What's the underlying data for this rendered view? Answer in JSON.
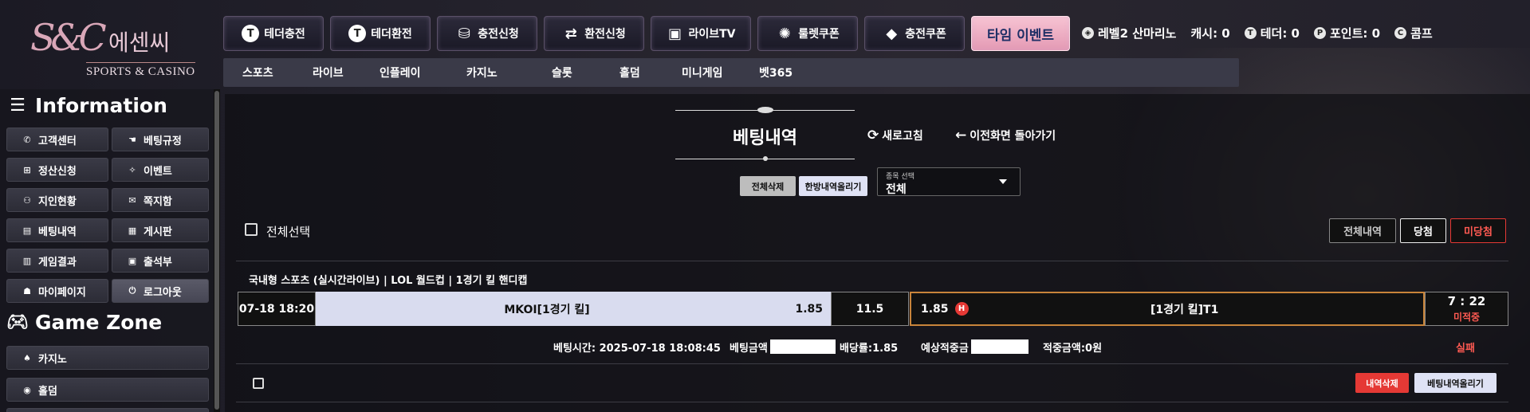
{
  "logo": {
    "mark": "S&C",
    "korean": "에센씨",
    "sub": "SPORTS & CASINO"
  },
  "top_buttons": [
    {
      "label": "테더충전",
      "icon": "tether-icon"
    },
    {
      "label": "테더환전",
      "icon": "tether-icon"
    },
    {
      "label": "충전신청",
      "icon": "coins-icon"
    },
    {
      "label": "환전신청",
      "icon": "exchange-icon"
    },
    {
      "label": "라이브TV",
      "icon": "live-tv-icon"
    },
    {
      "label": "룰렛쿠폰",
      "icon": "roulette-icon"
    },
    {
      "label": "충전쿠폰",
      "icon": "coupon-icon"
    }
  ],
  "event_button": "타임 이벤트",
  "status": {
    "level": "레벨2 산마리노",
    "cash": "캐시: 0",
    "tether": "테더: 0",
    "points": "포인트: 0",
    "comp": "콤프"
  },
  "categories": [
    "스포츠",
    "라이브",
    "인플레이",
    "카지노",
    "슬롯",
    "홀덤",
    "미니게임",
    "벳365"
  ],
  "sidebar": {
    "information_title": "Information",
    "info_items": [
      {
        "label": "고객센터",
        "icon": "phone-icon"
      },
      {
        "label": "베팅규정",
        "icon": "hand-icon"
      },
      {
        "label": "정산신청",
        "icon": "settlement-icon"
      },
      {
        "label": "이벤트",
        "icon": "sparkle-icon"
      },
      {
        "label": "지인현황",
        "icon": "people-icon"
      },
      {
        "label": "쪽지함",
        "icon": "message-icon"
      },
      {
        "label": "베팅내역",
        "icon": "list-icon"
      },
      {
        "label": "게시판",
        "icon": "board-icon"
      },
      {
        "label": "게임결과",
        "icon": "result-icon"
      },
      {
        "label": "출석부",
        "icon": "calendar-icon"
      },
      {
        "label": "마이페이지",
        "icon": "user-icon"
      },
      {
        "label": "로그아웃",
        "icon": "power-icon"
      }
    ],
    "gamezone_title": "Game Zone",
    "game_items": [
      {
        "label": "카지노",
        "icon": "spade-icon"
      },
      {
        "label": "홀덤",
        "icon": "chip-icon"
      }
    ]
  },
  "main": {
    "title": "베팅내역",
    "refresh": "새로고침",
    "back": "이전화면 돌아가기",
    "delete_all": "전체삭제",
    "post_all": "한방내역올리기",
    "select_label": "종목 선택",
    "select_value": "전체",
    "select_all": "전체선택",
    "filters": {
      "all": "전체내역",
      "win": "당첨",
      "lose": "미당첨"
    },
    "bet": {
      "header": "국내형 스포츠 (실시간라이브) | LOL 월드컵 | 1경기 킬 핸디캡",
      "time": "07-18 18:20",
      "home": "MKOI[1경기 킬]",
      "home_odds": "1.85",
      "line": "11.5",
      "away_odds": "1.85",
      "away_badge": "H",
      "away": "[1경기 킬]T1",
      "score": "7 : 22",
      "score_status": "미적중",
      "bet_time": "베팅시간: 2025-07-18 18:08:45",
      "bet_amount_label": "베팅금액",
      "odds": "배당률:1.85",
      "expected_label": "예상적중금",
      "hit_amount": "적중금액:0원",
      "result": "실패"
    },
    "delete_history": "내역삭제",
    "post_history": "베팅내역올리기"
  },
  "colors": {
    "accent_red": "#e53935",
    "selected_row": "#d9dcef",
    "orange_border": "#c8843a"
  }
}
